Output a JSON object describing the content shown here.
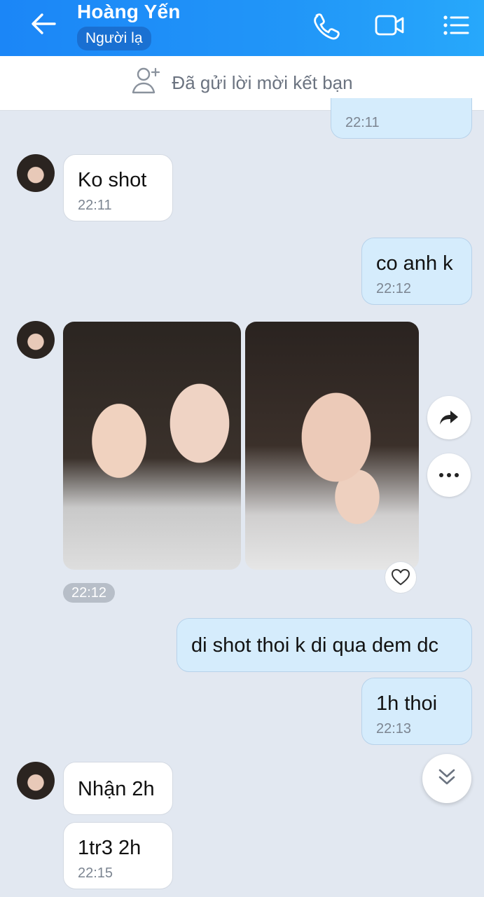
{
  "header": {
    "name": "Hoàng Yến",
    "badge": "Người lạ"
  },
  "friend_bar": {
    "label": "Đã gửi lời mời kết bạn"
  },
  "messages": [
    {
      "side": "out",
      "text": "",
      "time": "22:11"
    },
    {
      "side": "in",
      "text": "Ko shot",
      "time": "22:11"
    },
    {
      "side": "out",
      "text": "co anh k",
      "time": "22:12"
    },
    {
      "side": "in",
      "type": "photos",
      "time": "22:12"
    },
    {
      "side": "out",
      "text": "di shot thoi k di qua dem dc",
      "time": ""
    },
    {
      "side": "out",
      "text": "1h thoi",
      "time": "22:13"
    },
    {
      "side": "in",
      "text": "Nhận 2h",
      "time": ""
    },
    {
      "side": "in",
      "text": "1tr3 2h",
      "time": "22:15"
    }
  ],
  "colors": {
    "header": "#1b86f7",
    "out_bubble": "#d5ecfc",
    "in_bubble": "#ffffff",
    "background": "#e2e8f1"
  }
}
